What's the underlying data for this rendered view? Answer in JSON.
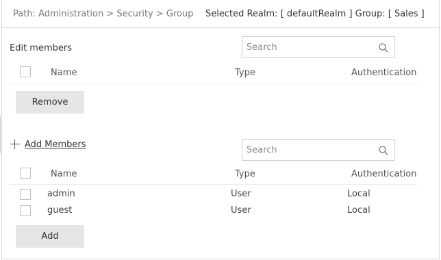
{
  "header": {
    "path": "Path: Administration > Security > Group",
    "realm": "Selected Realm: [ defaultRealm ]  Group: [ Sales ]"
  },
  "edit_members": {
    "title": "Edit members",
    "search_placeholder": "Search",
    "columns": {
      "name": "Name",
      "type": "Type",
      "auth": "Authentication"
    },
    "remove_label": "Remove"
  },
  "add_members": {
    "link_label": "Add Members",
    "search_placeholder": "Search",
    "columns": {
      "name": "Name",
      "type": "Type",
      "auth": "Authentication"
    },
    "rows": [
      {
        "name": "admin",
        "type": "User",
        "auth": "Local"
      },
      {
        "name": "guest",
        "type": "User",
        "auth": "Local"
      }
    ],
    "add_label": "Add"
  }
}
